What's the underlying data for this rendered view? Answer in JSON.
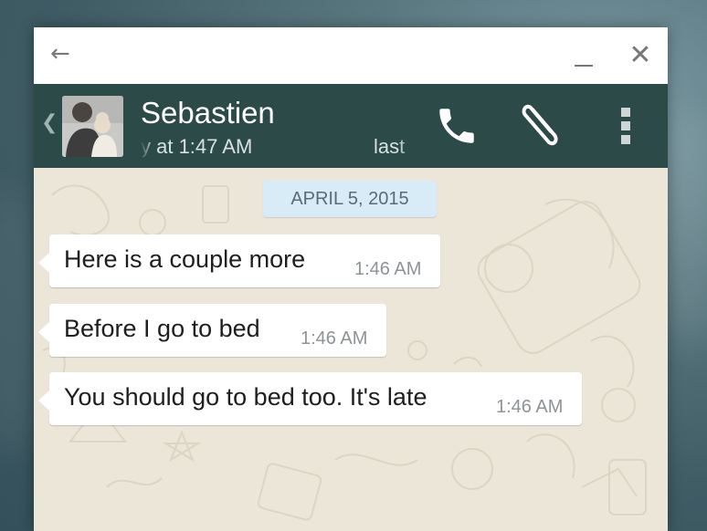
{
  "titlebar": {
    "back_icon": "arrow-left-icon",
    "minimize_icon": "minimize-icon",
    "close_icon": "close-icon"
  },
  "header": {
    "contact_name": "Sebastien",
    "status_left": "y at 1:47 AM",
    "status_right": "last",
    "icons": [
      "chevron-left-icon",
      "phone-icon",
      "paperclip-icon",
      "more-vertical-icon"
    ],
    "background_color": "#2c4a48"
  },
  "chat": {
    "date_label": "APRIL 5, 2015",
    "messages": [
      {
        "text": "Here is a couple more",
        "time": "1:46 AM"
      },
      {
        "text": "Before I go to bed",
        "time": "1:46 AM"
      },
      {
        "text": "You should go to bed too. It's late",
        "time": "1:46 AM"
      }
    ],
    "background_color": "#ece6d8"
  }
}
